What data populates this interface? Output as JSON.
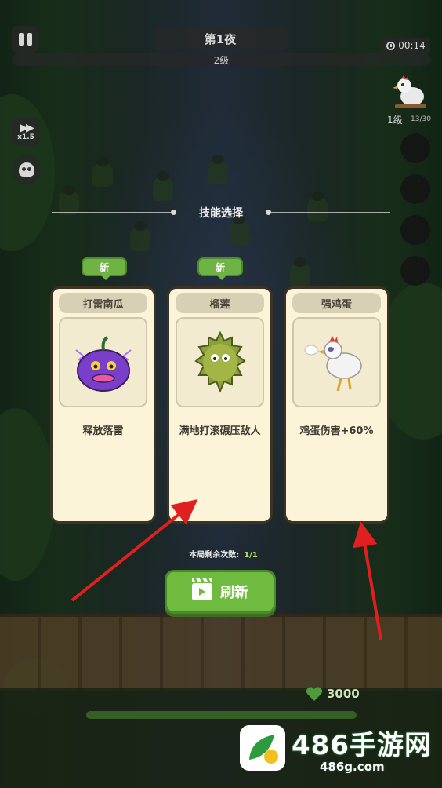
{
  "hud": {
    "night_label": "第1夜",
    "level_label": "2级",
    "timer": "00:14",
    "speed_label": "x1.5",
    "chicken_level": "1级",
    "chicken_count": "13/30"
  },
  "skill_select": {
    "title": "技能选择",
    "new_badge": "新",
    "cards": [
      {
        "name": "打雷南瓜",
        "description": "释放落雷",
        "is_new": true,
        "art": "thunder-pumpkin"
      },
      {
        "name": "榴莲",
        "description": "满地打滚碾压敌人",
        "is_new": true,
        "art": "durian"
      },
      {
        "name": "强鸡蛋",
        "description": "鸡蛋伤害+60%",
        "is_new": false,
        "art": "egg-chicken"
      }
    ],
    "remaining_label": "本局剩余次数:",
    "remaining_value": "1/1",
    "refresh_label": "刷新"
  },
  "base": {
    "hp": "3000"
  },
  "watermark": {
    "title": "486手游网",
    "url": "486g.com"
  },
  "colors": {
    "card_bg": "#fbf4d9",
    "accent_green": "#6fbb3f",
    "arrow_red": "#e02020"
  }
}
